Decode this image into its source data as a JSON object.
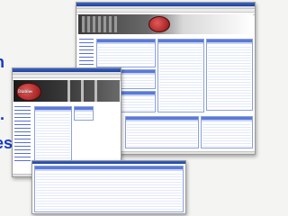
{
  "background": {
    "text_fragments": [
      "h",
      "t.",
      "es"
    ],
    "accent_color": "#1638c8"
  },
  "windows": [
    {
      "name": "stats-window-back",
      "logo_text": ""
    },
    {
      "name": "stats-window-front",
      "logo_text": "Diablos"
    },
    {
      "name": "stats-table-window"
    }
  ],
  "colors": {
    "table_header": "#5a7ad8",
    "table_row_alt": "#e3e9f9",
    "titlebar": "#1d3f9a"
  }
}
